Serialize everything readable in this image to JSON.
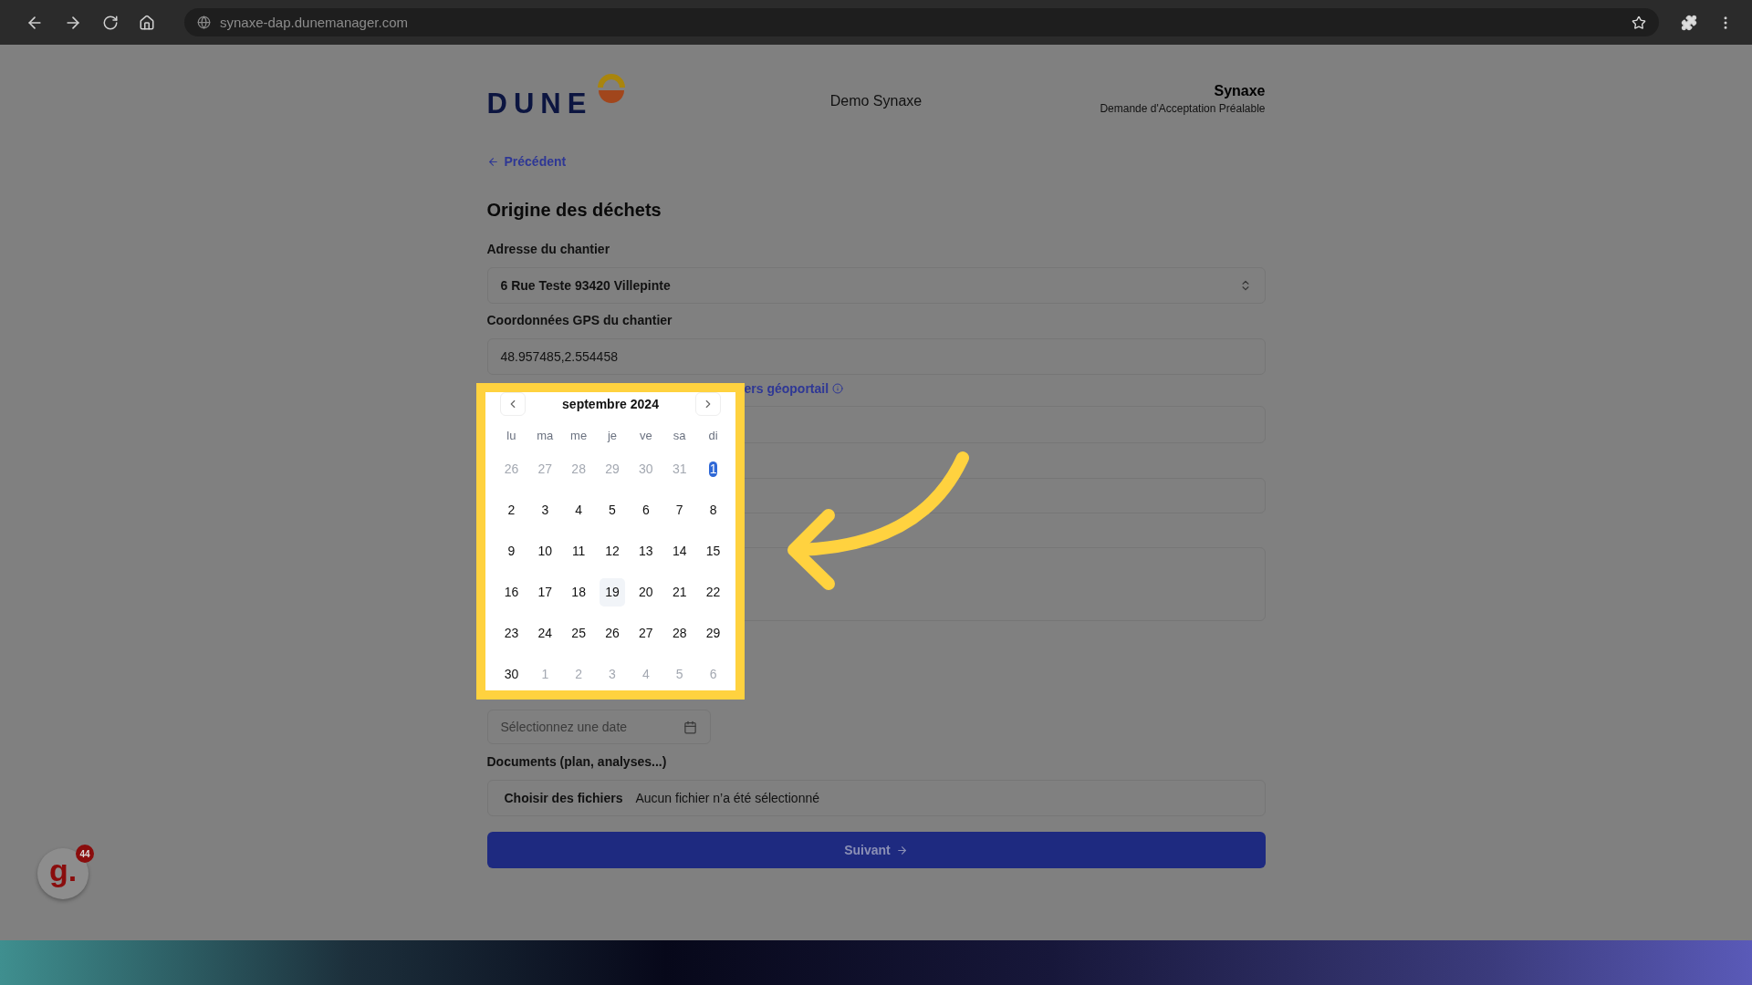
{
  "browser": {
    "url": "synaxe-dap.dunemanager.com"
  },
  "header": {
    "logo_text": "DUNE",
    "center_title": "Demo Synaxe",
    "org_name": "Synaxe",
    "org_subtitle": "Demande d'Acceptation Préalable"
  },
  "back_link": "Précédent",
  "section_title": "Origine des déchets",
  "fields": [
    {
      "kind": "select",
      "label": "Adresse du chantier",
      "value": "6 Rue Teste 93420 Villepinte"
    },
    {
      "kind": "text",
      "label": "Coordonnées GPS du chantier",
      "value": "48.957485,2.554458"
    },
    {
      "kind": "link",
      "text": "ers géoportail"
    },
    {
      "kind": "text"
    },
    {
      "kind": "text"
    },
    {
      "kind": "textarea"
    },
    {
      "kind": "date",
      "placeholder": "Sélectionnez une date"
    },
    {
      "kind": "file",
      "label": "Documents (plan, analyses...)",
      "button": "Choisir des fichiers",
      "status": "Aucun fichier n’a été sélectionné"
    }
  ],
  "submit": "Suivant",
  "calendar": {
    "month": "septembre 2024",
    "weekdays": [
      "lu",
      "ma",
      "me",
      "je",
      "ve",
      "sa",
      "di"
    ],
    "days": [
      {
        "label": "26",
        "outside": true,
        "selected": false,
        "today": false
      },
      {
        "label": "27",
        "outside": true,
        "selected": false,
        "today": false
      },
      {
        "label": "28",
        "outside": true,
        "selected": false,
        "today": false
      },
      {
        "label": "29",
        "outside": true,
        "selected": false,
        "today": false
      },
      {
        "label": "30",
        "outside": true,
        "selected": false,
        "today": false
      },
      {
        "label": "31",
        "outside": true,
        "selected": false,
        "today": false
      },
      {
        "label": "1",
        "outside": false,
        "selected": true,
        "today": false
      },
      {
        "label": "2",
        "outside": false,
        "selected": false,
        "today": false
      },
      {
        "label": "3",
        "outside": false,
        "selected": false,
        "today": false
      },
      {
        "label": "4",
        "outside": false,
        "selected": false,
        "today": false
      },
      {
        "label": "5",
        "outside": false,
        "selected": false,
        "today": false
      },
      {
        "label": "6",
        "outside": false,
        "selected": false,
        "today": false
      },
      {
        "label": "7",
        "outside": false,
        "selected": false,
        "today": false
      },
      {
        "label": "8",
        "outside": false,
        "selected": false,
        "today": false
      },
      {
        "label": "9",
        "outside": false,
        "selected": false,
        "today": false
      },
      {
        "label": "10",
        "outside": false,
        "selected": false,
        "today": false
      },
      {
        "label": "11",
        "outside": false,
        "selected": false,
        "today": false
      },
      {
        "label": "12",
        "outside": false,
        "selected": false,
        "today": false
      },
      {
        "label": "13",
        "outside": false,
        "selected": false,
        "today": false
      },
      {
        "label": "14",
        "outside": false,
        "selected": false,
        "today": false
      },
      {
        "label": "15",
        "outside": false,
        "selected": false,
        "today": false
      },
      {
        "label": "16",
        "outside": false,
        "selected": false,
        "today": false
      },
      {
        "label": "17",
        "outside": false,
        "selected": false,
        "today": false
      },
      {
        "label": "18",
        "outside": false,
        "selected": false,
        "today": false
      },
      {
        "label": "19",
        "outside": false,
        "selected": false,
        "today": true
      },
      {
        "label": "20",
        "outside": false,
        "selected": false,
        "today": false
      },
      {
        "label": "21",
        "outside": false,
        "selected": false,
        "today": false
      },
      {
        "label": "22",
        "outside": false,
        "selected": false,
        "today": false
      },
      {
        "label": "23",
        "outside": false,
        "selected": false,
        "today": false
      },
      {
        "label": "24",
        "outside": false,
        "selected": false,
        "today": false
      },
      {
        "label": "25",
        "outside": false,
        "selected": false,
        "today": false
      },
      {
        "label": "26",
        "outside": false,
        "selected": false,
        "today": false
      },
      {
        "label": "27",
        "outside": false,
        "selected": false,
        "today": false
      },
      {
        "label": "28",
        "outside": false,
        "selected": false,
        "today": false
      },
      {
        "label": "29",
        "outside": false,
        "selected": false,
        "today": false
      },
      {
        "label": "30",
        "outside": false,
        "selected": false,
        "today": false
      },
      {
        "label": "1",
        "outside": true,
        "selected": false,
        "today": false
      },
      {
        "label": "2",
        "outside": true,
        "selected": false,
        "today": false
      },
      {
        "label": "3",
        "outside": true,
        "selected": false,
        "today": false
      },
      {
        "label": "4",
        "outside": true,
        "selected": false,
        "today": false
      },
      {
        "label": "5",
        "outside": true,
        "selected": false,
        "today": false
      },
      {
        "label": "6",
        "outside": true,
        "selected": false,
        "today": false
      }
    ]
  },
  "badge": {
    "logo": "g.",
    "count": "44"
  }
}
